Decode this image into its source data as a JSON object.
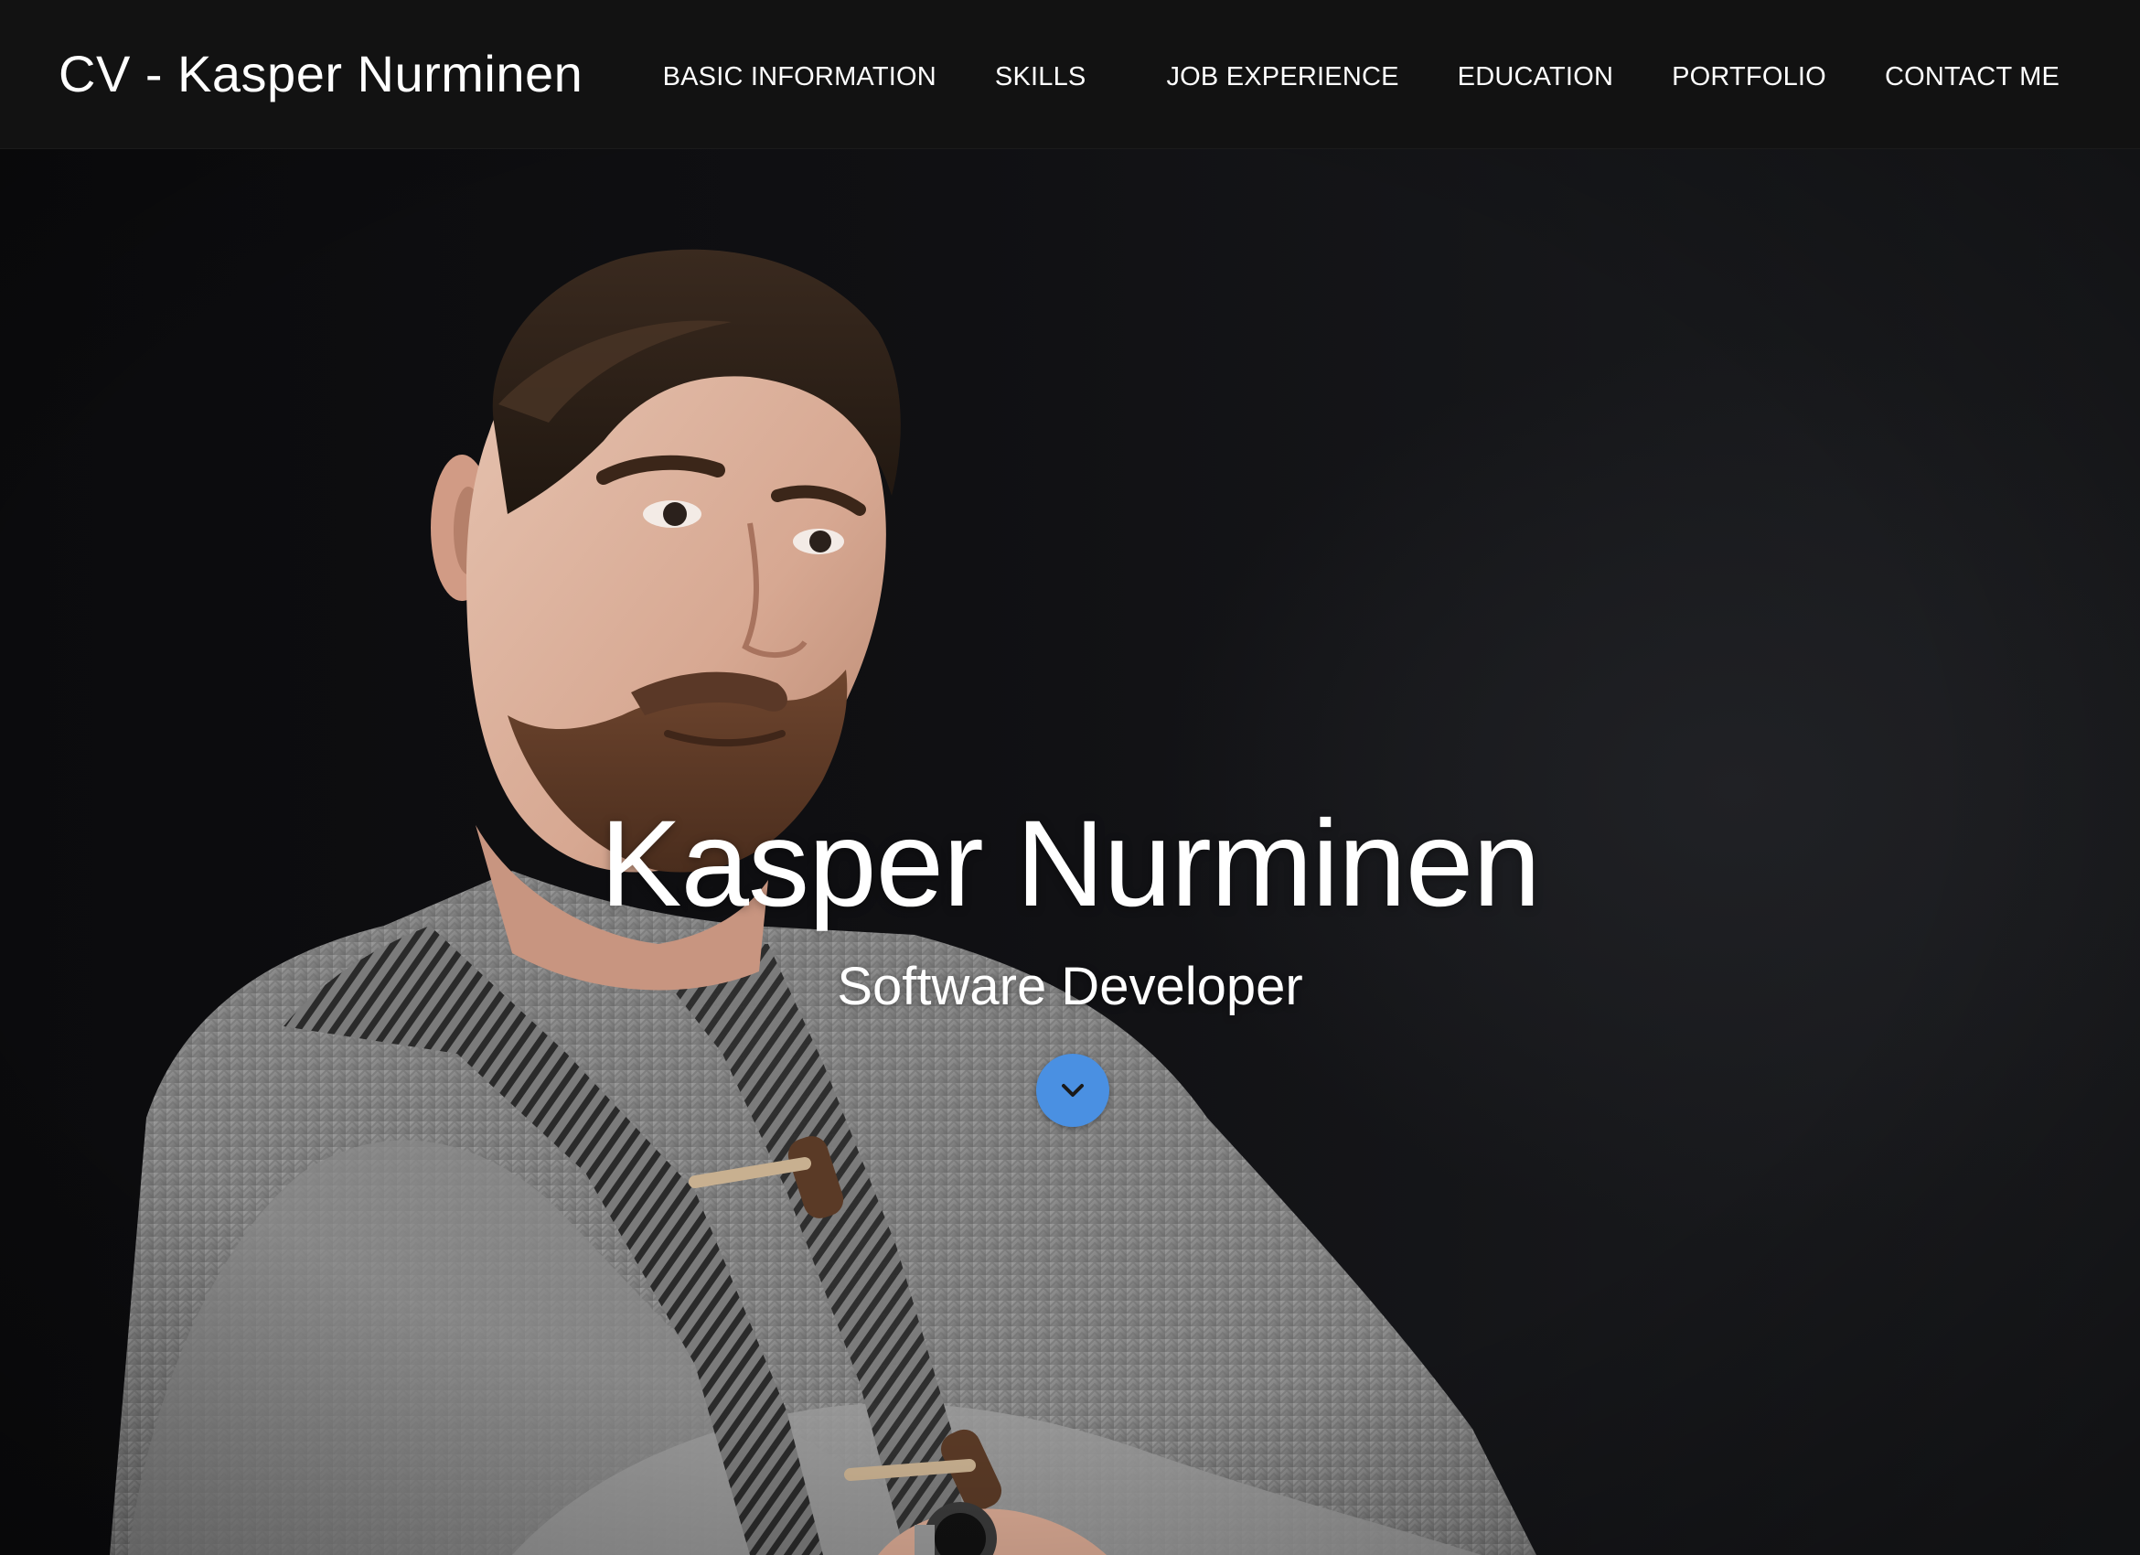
{
  "navbar": {
    "brand": "CV - Kasper Nurminen",
    "items": [
      {
        "label": "BASIC INFORMATION"
      },
      {
        "label": "SKILLS"
      },
      {
        "label": "JOB EXPERIENCE"
      },
      {
        "label": "EDUCATION"
      },
      {
        "label": "PORTFOLIO"
      },
      {
        "label": "CONTACT ME"
      }
    ]
  },
  "hero": {
    "name": "Kasper Nurminen",
    "subtitle": "Software Developer",
    "scroll_icon": "chevron-down-icon",
    "photo_subject": "portrait-photo"
  },
  "colors": {
    "navbar_bg": "#121212",
    "hero_bg": "#0f0f11",
    "accent": "#4a90e2",
    "text": "#ffffff",
    "sweater": "#8d8d8d"
  }
}
